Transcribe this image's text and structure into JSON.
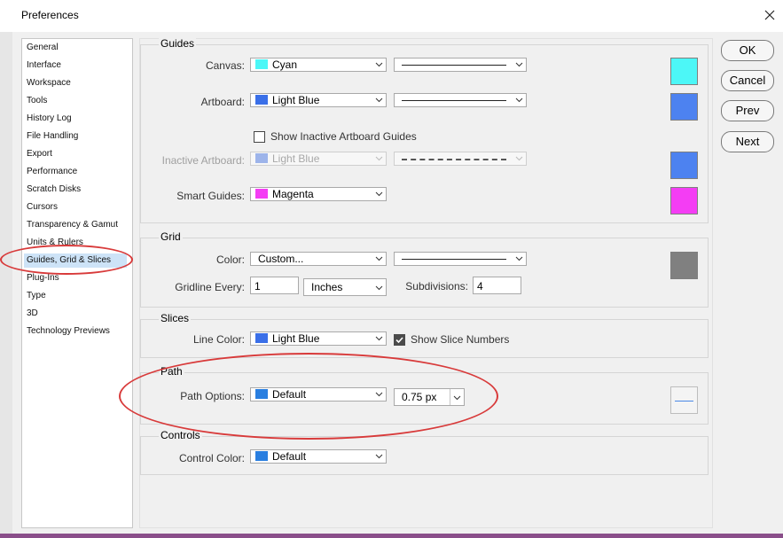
{
  "window": {
    "title": "Preferences"
  },
  "sidebar": {
    "items": [
      "General",
      "Interface",
      "Workspace",
      "Tools",
      "History Log",
      "File Handling",
      "Export",
      "Performance",
      "Scratch Disks",
      "Cursors",
      "Transparency & Gamut",
      "Units & Rulers",
      "Guides, Grid & Slices",
      "Plug-Ins",
      "Type",
      "3D",
      "Technology Previews"
    ],
    "selected": "Guides, Grid & Slices"
  },
  "buttons": {
    "ok": "OK",
    "cancel": "Cancel",
    "prev": "Prev",
    "next": "Next"
  },
  "guides": {
    "heading": "Guides",
    "canvas_label": "Canvas:",
    "canvas_value": "Cyan",
    "canvas_color": "#4cf7f7",
    "artboard_label": "Artboard:",
    "artboard_value": "Light Blue",
    "artboard_color": "#3a6fe8",
    "show_inactive_label": "Show Inactive Artboard Guides",
    "inactive_label": "Inactive Artboard:",
    "inactive_value": "Light Blue",
    "smart_label": "Smart Guides:",
    "smart_value": "Magenta",
    "smart_color": "#f43df4"
  },
  "grid": {
    "heading": "Grid",
    "color_label": "Color:",
    "color_value": "Custom...",
    "color_swatch": "#808080",
    "gridline_label": "Gridline Every:",
    "gridline_value": "1",
    "unit_value": "Inches",
    "subdivisions_label": "Subdivisions:",
    "subdivisions_value": "4"
  },
  "slices": {
    "heading": "Slices",
    "line_color_label": "Line Color:",
    "line_color_value": "Light Blue",
    "show_numbers_label": "Show Slice Numbers"
  },
  "path": {
    "heading": "Path",
    "options_label": "Path Options:",
    "options_value": "Default",
    "options_color": "#2a7fe0",
    "width_value": "0.75 px"
  },
  "controls": {
    "heading": "Controls",
    "color_label": "Control Color:",
    "color_value": "Default"
  },
  "accents": {
    "annotation_red": "#d83a3a",
    "selection_blue": "#cde3f7"
  }
}
